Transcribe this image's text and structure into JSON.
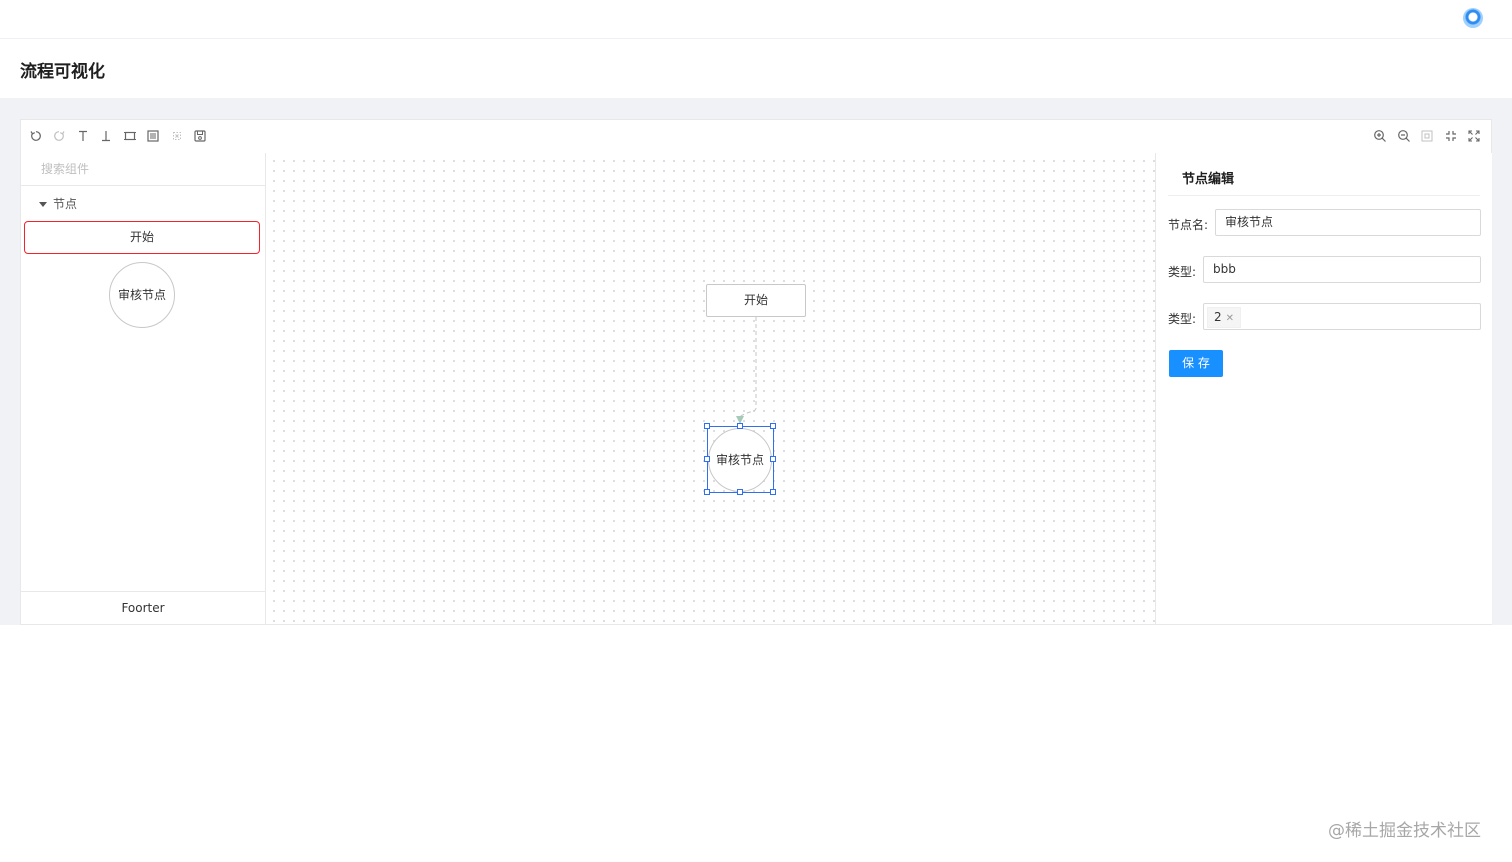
{
  "page": {
    "title": "流程可视化"
  },
  "toolbar": {
    "left_icons": [
      "undo-icon",
      "redo-icon",
      "bring-to-front-icon",
      "send-to-back-icon",
      "fit-content-icon",
      "full-view-icon",
      "clear-icon",
      "save-icon"
    ],
    "right_icons": [
      "zoom-in-icon",
      "zoom-out-icon",
      "fit-view-icon",
      "shrink-icon",
      "expand-icon"
    ]
  },
  "stencil": {
    "search_placeholder": "搜索组件",
    "group_label": "节点",
    "items": [
      {
        "label": "开始",
        "shape": "rect"
      },
      {
        "label": "审核节点",
        "shape": "circle"
      }
    ],
    "footer": "Foorter"
  },
  "canvas": {
    "nodes": [
      {
        "label": "开始",
        "shape": "rect"
      },
      {
        "label": "审核节点",
        "shape": "circle",
        "selected": true
      }
    ]
  },
  "editor_panel": {
    "title": "节点编辑",
    "fields": [
      {
        "label": "节点名:",
        "value": "审核节点"
      },
      {
        "label": "类型:",
        "value": "bbb"
      },
      {
        "label": "类型:",
        "tags": [
          "2"
        ]
      }
    ],
    "save_label": "保 存",
    "accent": "#1890ff"
  },
  "watermark": "@稀土掘金技术社区"
}
